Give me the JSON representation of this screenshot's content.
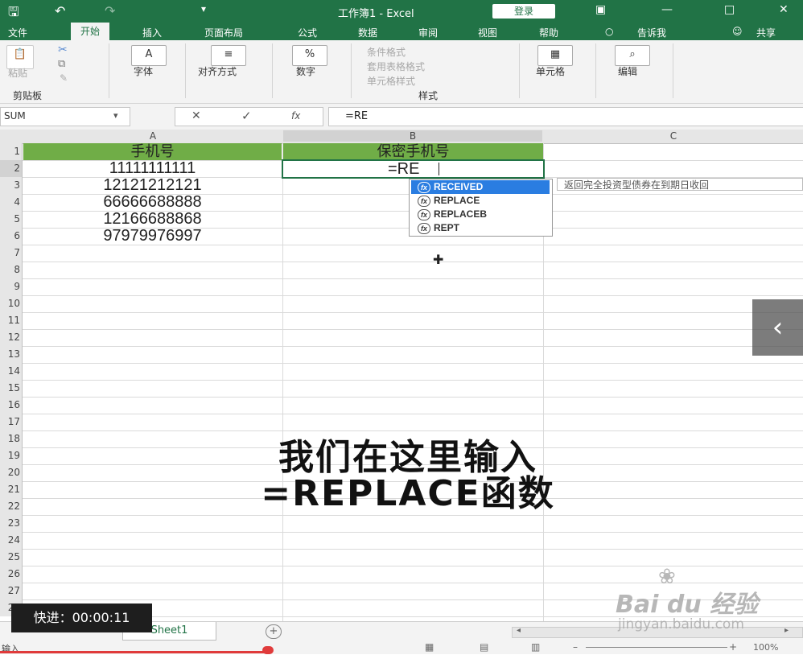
{
  "titlebar": {
    "title": "工作簿1  -  Excel",
    "login": "登录",
    "qa_icons": [
      "save-icon",
      "undo-icon",
      "redo-icon",
      "customize-icon"
    ]
  },
  "tabs": [
    "文件",
    "开始",
    "插入",
    "页面布局",
    "公式",
    "数据",
    "审阅",
    "视图",
    "帮助",
    "告诉我",
    "共享"
  ],
  "ribbon": {
    "paste": "粘贴",
    "clipboard": "剪贴板",
    "font": "字体",
    "align": "对齐方式",
    "number": "数字",
    "cond_format": "条件格式",
    "table_format": "套用表格格式",
    "cell_style": "单元格样式",
    "styles": "样式",
    "cells": "单元格",
    "edit": "编辑"
  },
  "formula_bar": {
    "name_box": "SUM",
    "formula": "=RE",
    "fx": "fx"
  },
  "columns": [
    "A",
    "B",
    "C"
  ],
  "rows": [
    "1",
    "2",
    "3",
    "4",
    "5",
    "6",
    "7",
    "8",
    "9",
    "10",
    "11",
    "12",
    "13",
    "14",
    "15",
    "16",
    "17",
    "18",
    "19",
    "20",
    "21",
    "22",
    "23",
    "24",
    "25",
    "26",
    "27",
    "28"
  ],
  "sheet": {
    "header_a": "手机号",
    "header_b": "保密手机号",
    "phones": [
      "11111111111",
      "12121212121",
      "66666688888",
      "12166688868",
      "97979976997"
    ],
    "editing": "=RE"
  },
  "autocomplete": {
    "items": [
      "RECEIVED",
      "REPLACE",
      "REPLACEB",
      "REPT"
    ],
    "tooltip": "返回完全投资型债券在到期日收回"
  },
  "caption": {
    "line1": "我们在这里输入",
    "line2": "=REPLACE函数"
  },
  "bottom": {
    "sheet_tab": "Sheet1",
    "status": "输入",
    "zoom": "100%",
    "speed": "快进：00:00:11"
  },
  "watermark": {
    "brand": "Bai du 经验",
    "url": "jingyan.baidu.com"
  },
  "colors": {
    "excel_green": "#217346",
    "header_fill": "#70ad47",
    "selection_blue": "#2a7de1"
  }
}
